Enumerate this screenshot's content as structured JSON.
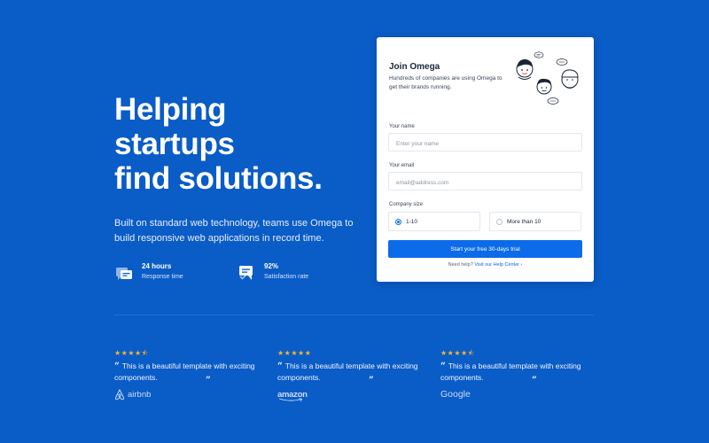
{
  "hero": {
    "title_line1": "Helping startups",
    "title_line2": "find solutions.",
    "subtitle": "Built on standard web technology, teams use Omega to build responsive web applications in record time.",
    "stats": [
      {
        "value": "24 hours",
        "label": "Response time",
        "icon": "chat-bubbles-icon"
      },
      {
        "value": "92%",
        "label": "Satisfaction rate",
        "icon": "chat-check-icon"
      }
    ]
  },
  "form": {
    "title": "Join Omega",
    "subtitle": "Hundreds of companies are using Omega to get their brands running.",
    "name_label": "Your name",
    "name_placeholder": "Enter your name",
    "email_label": "Your email",
    "email_placeholder": "email@address.com",
    "company_label": "Company size",
    "company_options": [
      "1-10",
      "More than 10"
    ],
    "company_selected": "1-10",
    "cta_label": "Start your free 30-days trial",
    "help_text": "Need help?",
    "help_link": "Visit our Help Center"
  },
  "reviews": [
    {
      "rating": 4.5,
      "stars": "★★★★⯪",
      "quote": "This is a beautiful template with exciting components.",
      "brand": "airbnb"
    },
    {
      "rating": 5,
      "stars": "★★★★★",
      "quote": "This is a beautiful template with exciting components.",
      "brand": "amazon"
    },
    {
      "rating": 4.5,
      "stars": "★★★★⯪",
      "quote": "This is a beautiful template with exciting components.",
      "brand": "Google"
    }
  ],
  "colors": {
    "background": "#0a5cc7",
    "accent": "#0c6be8",
    "star": "#f5b731"
  }
}
